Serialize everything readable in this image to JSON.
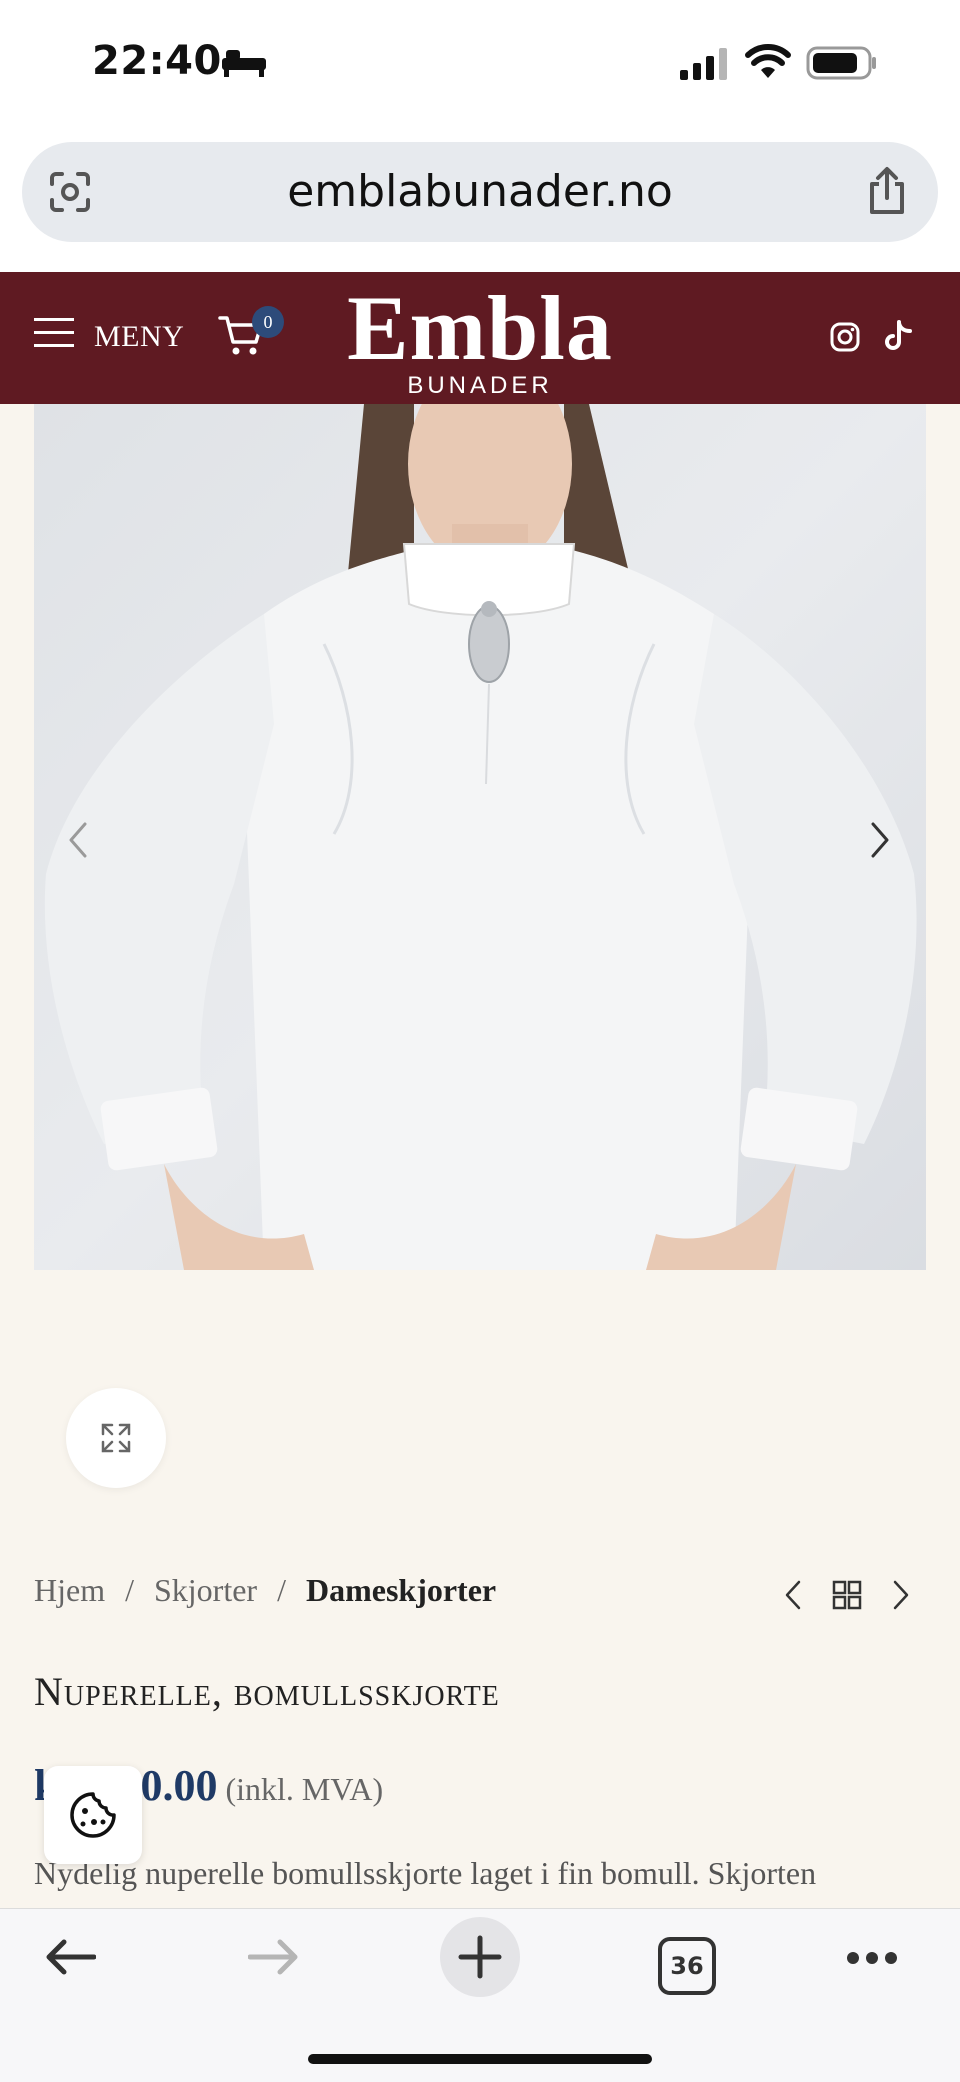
{
  "status_bar": {
    "time": "22:40"
  },
  "browser": {
    "url": "emblabunader.no",
    "tab_count": "36"
  },
  "site_header": {
    "menu_label": "MENY",
    "cart_count": "0",
    "logo_title": "Embla",
    "logo_subtitle": "BUNADER",
    "background_color": "#5f1a22"
  },
  "breadcrumb": {
    "home": "Hjem",
    "category": "Skjorter",
    "current": "Dameskjorter",
    "separator": "/"
  },
  "product": {
    "title": "Nuperelle, bomullsskjorte",
    "price_amount": "00.00",
    "price_prefix": "k",
    "vat_note": "(inkl. MVA)",
    "description": "Nydelig nuperelle bomullsskjorte laget i fin bomull. Skjorten"
  },
  "colors": {
    "page_background": "#f9f5ee",
    "price_color": "#1f3a66"
  }
}
